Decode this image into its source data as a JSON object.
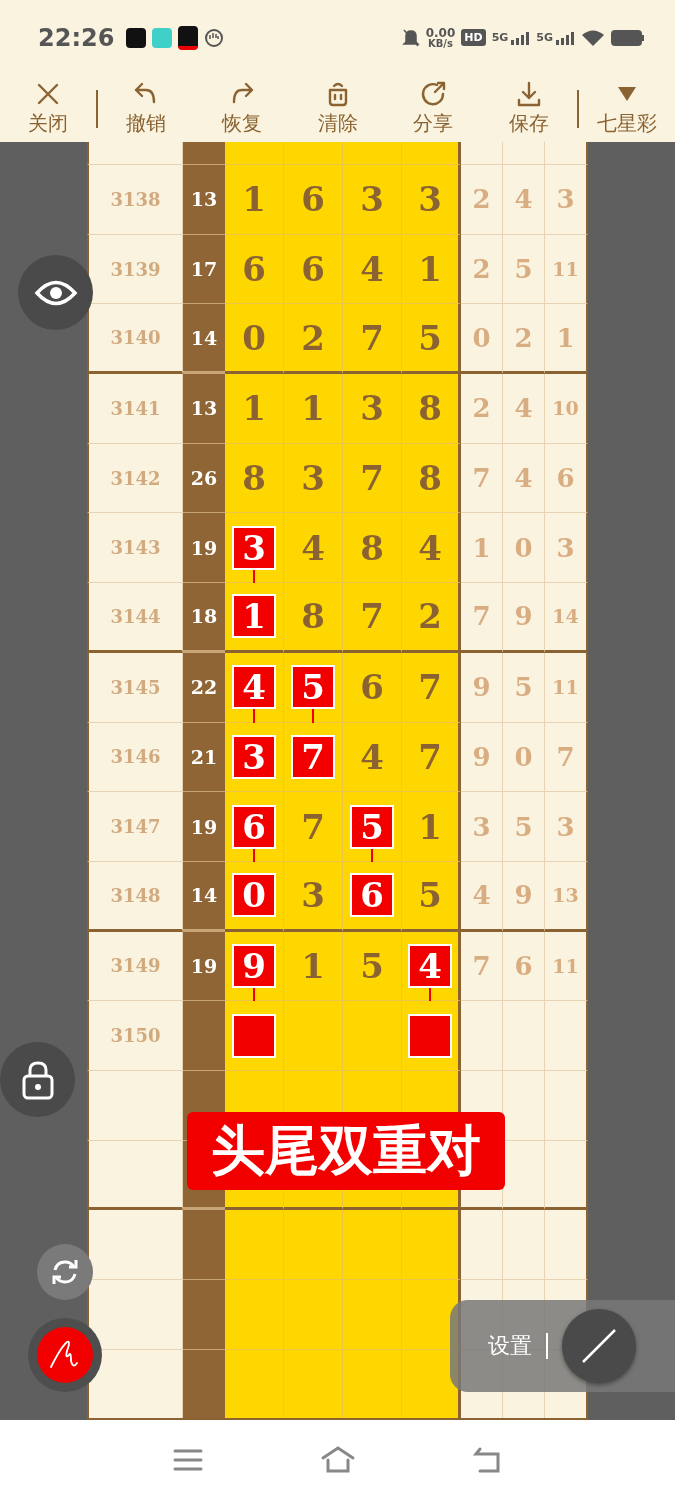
{
  "status_bar": {
    "time": "22:26",
    "speed_value": "0.00",
    "speed_unit": "KB/s",
    "hd": "HD",
    "sim_1": "5G",
    "sim_2": "5G"
  },
  "toolbar": [
    {
      "label": "关闭"
    },
    {
      "label": "撤销"
    },
    {
      "label": "恢复"
    },
    {
      "label": "清除"
    },
    {
      "label": "分享"
    },
    {
      "label": "保存"
    },
    {
      "label": "七星彩"
    }
  ],
  "rows": [
    {
      "period": "3138",
      "sum": "13",
      "group_end": false,
      "digits": [
        {
          "v": "1",
          "marked": false
        },
        {
          "v": "6",
          "marked": false
        },
        {
          "v": "3",
          "marked": false
        },
        {
          "v": "3",
          "marked": false
        }
      ],
      "tail": [
        "2",
        "4",
        "3"
      ]
    },
    {
      "period": "3139",
      "sum": "17",
      "group_end": false,
      "digits": [
        {
          "v": "6",
          "marked": false
        },
        {
          "v": "6",
          "marked": false
        },
        {
          "v": "4",
          "marked": false
        },
        {
          "v": "1",
          "marked": false
        }
      ],
      "tail": [
        "2",
        "5",
        "11"
      ]
    },
    {
      "period": "3140",
      "sum": "14",
      "group_end": true,
      "digits": [
        {
          "v": "0",
          "marked": false
        },
        {
          "v": "2",
          "marked": false
        },
        {
          "v": "7",
          "marked": false
        },
        {
          "v": "5",
          "marked": false
        }
      ],
      "tail": [
        "0",
        "2",
        "1"
      ]
    },
    {
      "period": "3141",
      "sum": "13",
      "group_end": false,
      "digits": [
        {
          "v": "1",
          "marked": false
        },
        {
          "v": "1",
          "marked": false
        },
        {
          "v": "3",
          "marked": false
        },
        {
          "v": "8",
          "marked": false
        }
      ],
      "tail": [
        "2",
        "4",
        "10"
      ]
    },
    {
      "period": "3142",
      "sum": "26",
      "group_end": false,
      "digits": [
        {
          "v": "8",
          "marked": false
        },
        {
          "v": "3",
          "marked": false
        },
        {
          "v": "7",
          "marked": false
        },
        {
          "v": "8",
          "marked": false
        }
      ],
      "tail": [
        "7",
        "4",
        "6"
      ]
    },
    {
      "period": "3143",
      "sum": "19",
      "group_end": false,
      "digits": [
        {
          "v": "3",
          "marked": true,
          "linked": true
        },
        {
          "v": "4",
          "marked": false
        },
        {
          "v": "8",
          "marked": false
        },
        {
          "v": "4",
          "marked": false
        }
      ],
      "tail": [
        "1",
        "0",
        "3"
      ]
    },
    {
      "period": "3144",
      "sum": "18",
      "group_end": true,
      "digits": [
        {
          "v": "1",
          "marked": true
        },
        {
          "v": "8",
          "marked": false
        },
        {
          "v": "7",
          "marked": false
        },
        {
          "v": "2",
          "marked": false
        }
      ],
      "tail": [
        "7",
        "9",
        "14"
      ]
    },
    {
      "period": "3145",
      "sum": "22",
      "group_end": false,
      "digits": [
        {
          "v": "4",
          "marked": true,
          "linked": true
        },
        {
          "v": "5",
          "marked": true,
          "linked": true
        },
        {
          "v": "6",
          "marked": false
        },
        {
          "v": "7",
          "marked": false
        }
      ],
      "tail": [
        "9",
        "5",
        "11"
      ]
    },
    {
      "period": "3146",
      "sum": "21",
      "group_end": false,
      "digits": [
        {
          "v": "3",
          "marked": true
        },
        {
          "v": "7",
          "marked": true
        },
        {
          "v": "4",
          "marked": false
        },
        {
          "v": "7",
          "marked": false
        }
      ],
      "tail": [
        "9",
        "0",
        "7"
      ]
    },
    {
      "period": "3147",
      "sum": "19",
      "group_end": false,
      "digits": [
        {
          "v": "6",
          "marked": true,
          "linked": true
        },
        {
          "v": "7",
          "marked": false
        },
        {
          "v": "5",
          "marked": true,
          "linked": true
        },
        {
          "v": "1",
          "marked": false
        }
      ],
      "tail": [
        "3",
        "5",
        "3"
      ]
    },
    {
      "period": "3148",
      "sum": "14",
      "group_end": true,
      "digits": [
        {
          "v": "0",
          "marked": true
        },
        {
          "v": "3",
          "marked": false
        },
        {
          "v": "6",
          "marked": true
        },
        {
          "v": "5",
          "marked": false
        }
      ],
      "tail": [
        "4",
        "9",
        "13"
      ]
    },
    {
      "period": "3149",
      "sum": "19",
      "group_end": false,
      "digits": [
        {
          "v": "9",
          "marked": true,
          "linked": true
        },
        {
          "v": "1",
          "marked": false
        },
        {
          "v": "5",
          "marked": false
        },
        {
          "v": "4",
          "marked": true,
          "linked": true
        }
      ],
      "tail": [
        "7",
        "6",
        "11"
      ]
    },
    {
      "period": "3150",
      "group_end": false,
      "digits": [
        {
          "marked": true
        },
        {
          "marked": false
        },
        {
          "marked": false
        },
        {
          "marked": true
        }
      ]
    },
    {
      "group_end": false
    },
    {
      "group_end": true
    },
    {
      "group_end": false
    },
    {
      "group_end": false
    },
    {
      "group_end": false
    }
  ],
  "banner": "头尾双重对",
  "settings_panel": {
    "label": "设置"
  }
}
